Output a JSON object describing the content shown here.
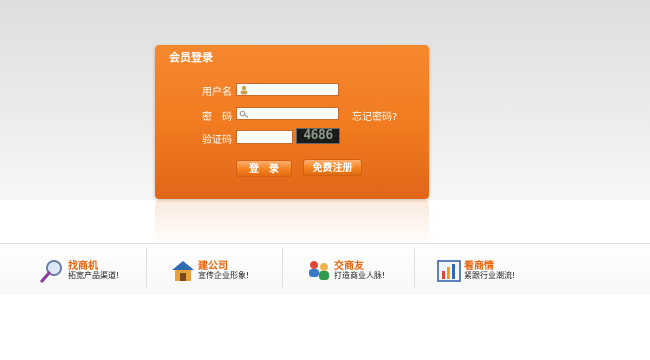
{
  "login": {
    "title": "会员登录",
    "username_label": "用户名",
    "password_label": "密　码",
    "captcha_label": "验证码",
    "captcha_text": "4686",
    "forgot_label": "忘记密码?",
    "login_button": "登　录",
    "register_button": "免费注册"
  },
  "features": [
    {
      "title": "找商机",
      "desc": "拓宽产品渠道!",
      "icon": "magnifier-icon"
    },
    {
      "title": "建公司",
      "desc": "宣传企业形象!",
      "icon": "house-icon"
    },
    {
      "title": "交商友",
      "desc": "打造商业人脉!",
      "icon": "people-icon"
    },
    {
      "title": "看商情",
      "desc": "紧跟行业潮流!",
      "icon": "bar-chart-icon"
    }
  ],
  "colors": {
    "accent": "#f07a1f",
    "feature_title": "#e8660e"
  }
}
